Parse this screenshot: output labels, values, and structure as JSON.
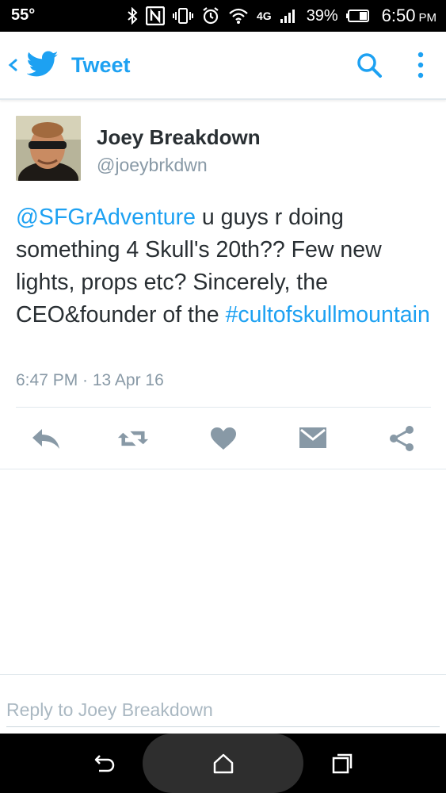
{
  "status_bar": {
    "temperature": "55°",
    "battery_percent": "39%",
    "time": "6:50",
    "ampm": "PM",
    "icons": [
      "bluetooth-icon",
      "nfc-icon",
      "vibrate-icon",
      "alarm-icon",
      "wifi-icon",
      "4g-lte-icon",
      "signal-icon",
      "battery-icon"
    ],
    "network_label": "4G"
  },
  "app_bar": {
    "title": "Tweet",
    "accent_color": "#1da1f2"
  },
  "tweet": {
    "author_name": "Joey Breakdown",
    "author_handle": "@joeybrkdwn",
    "mention": "@SFGrAdventure",
    "text_part1": " u guys r doing something 4 Skull's 20th?? Few new lights, props etc? Sincerely, the CEO&founder of the ",
    "hashtag": "#cultofskullmountain",
    "timestamp": "6:47 PM · 13 Apr 16"
  },
  "actions": [
    "reply-icon",
    "retweet-icon",
    "like-icon",
    "direct-message-icon",
    "share-icon"
  ],
  "reply": {
    "placeholder": "Reply to Joey Breakdown"
  },
  "nav_bar": {
    "buttons": [
      "back-icon",
      "home-icon",
      "recents-icon"
    ]
  }
}
